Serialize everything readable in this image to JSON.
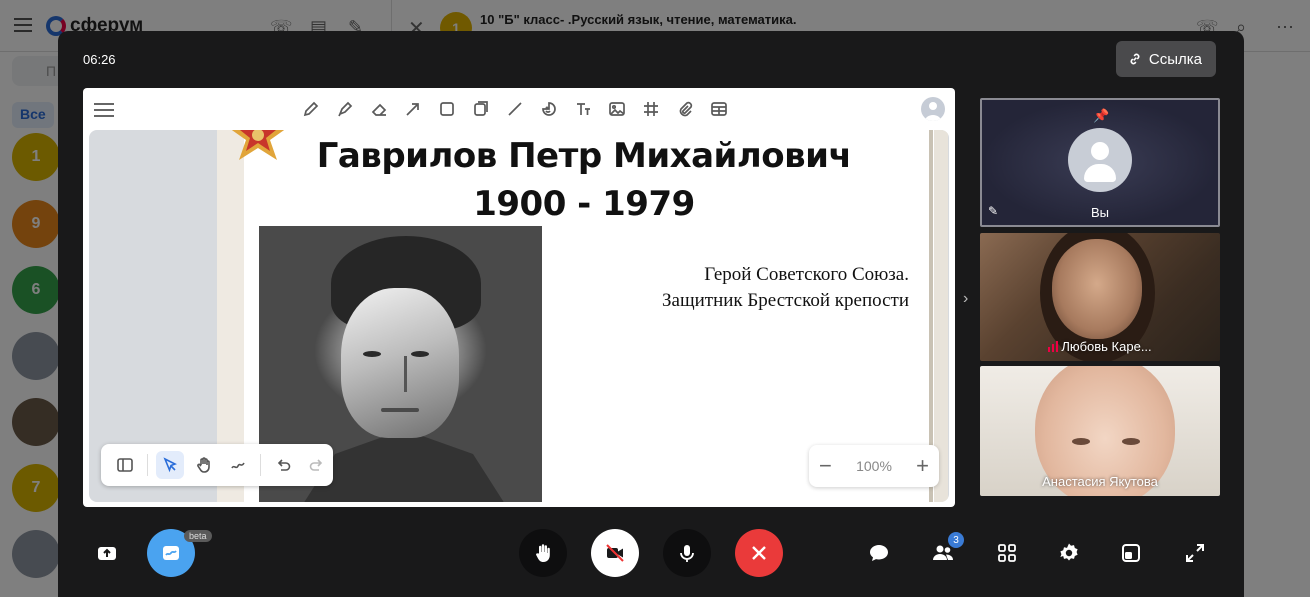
{
  "background": {
    "logo": "сферум",
    "search_placeholder": "П",
    "filter_all": "Все",
    "chat_title": "10 \"Б\" класс- .Русский язык, чтение, математика.",
    "chat_badge": "1",
    "avatars": [
      {
        "label": "1",
        "color": "#d9b400"
      },
      {
        "label": "9",
        "color": "#e8861a"
      },
      {
        "label": "6",
        "color": "#34a34a"
      },
      {
        "label": "",
        "color": "#8e96a3"
      },
      {
        "label": "",
        "color": "#6b5a48"
      },
      {
        "label": "7",
        "color": "#d9b400"
      },
      {
        "label": "",
        "color": "#8e96a3"
      }
    ]
  },
  "call": {
    "timer": "06:26",
    "link_label": "Ссылка"
  },
  "slide": {
    "title_line1": "Гаврилов Петр Михайлович",
    "title_line2": "1900 - 1979",
    "subtitle_line1": "Герой Советского Союза.",
    "subtitle_line2": "Защитник Брестской крепости"
  },
  "zoom": {
    "value": "100%"
  },
  "participants": {
    "you": "Вы",
    "p1": "Любовь Каре...",
    "p2": "Анастасия Якутова",
    "count": "3"
  },
  "controls": {
    "beta": "beta"
  },
  "colors": {
    "call_bg": "#19191a",
    "accent_blue": "#4aa3f0",
    "end_call_red": "#ea3a3a"
  }
}
